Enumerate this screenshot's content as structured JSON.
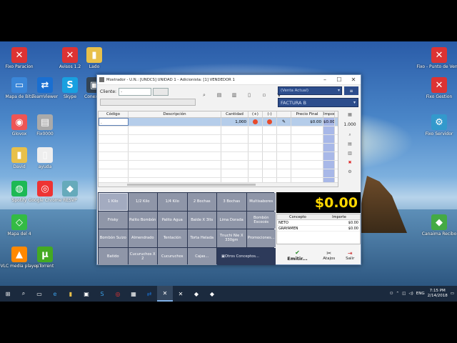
{
  "desktop": {
    "icons_left": [
      {
        "label": "Fixo Paracion",
        "glyph": "✕",
        "color": "#d33"
      },
      {
        "label": "Avisos 1.2",
        "glyph": "✕",
        "color": "#d33"
      },
      {
        "label": "Lado",
        "glyph": "▮",
        "color": "#e8c04a"
      },
      {
        "label": "Mapa de Bits",
        "glyph": "▭",
        "color": "#3a86d8"
      },
      {
        "label": "TeamViewer",
        "glyph": "⇄",
        "color": "#1a6fd1"
      },
      {
        "label": "Skype",
        "glyph": "S",
        "color": "#19a0e0"
      },
      {
        "label": "Conexion",
        "glyph": "▣",
        "color": "#345"
      },
      {
        "label": "Glovox",
        "glyph": "◉",
        "color": "#e55"
      },
      {
        "label": "Fix0000",
        "glyph": "▤",
        "color": "#aaa"
      },
      {
        "label": "David",
        "glyph": "▮",
        "color": "#e8c04a"
      },
      {
        "label": "ayuda",
        "glyph": "▯",
        "color": "#eee"
      },
      {
        "label": "Spotify",
        "glyph": "◍",
        "color": "#1db954"
      },
      {
        "label": "Google Chrome",
        "glyph": "◎",
        "color": "#e33"
      },
      {
        "label": "RESVP",
        "glyph": "◆",
        "color": "#6ab"
      },
      {
        "label": "Mapa del 4",
        "glyph": "◇",
        "color": "#3b4"
      },
      {
        "label": "VLC media player",
        "glyph": "▲",
        "color": "#f80"
      },
      {
        "label": "µTorrent",
        "glyph": "µ",
        "color": "#4a2"
      }
    ],
    "icons_right": [
      {
        "label": "Fixo - Punto de Venta",
        "glyph": "✕",
        "color": "#d33"
      },
      {
        "label": "Fixo Gestion",
        "glyph": "✕",
        "color": "#d33"
      },
      {
        "label": "Fixo Servidor",
        "glyph": "⚙",
        "color": "#39c"
      },
      {
        "label": "Canaima Recibo",
        "glyph": "◆",
        "color": "#4a4"
      }
    ]
  },
  "window": {
    "title": "Mostrador - U.N.: [UNDCS] UNIDAD 1 - Adicionista: [1] VENDEDOR 1",
    "cliente_label": "Cliente:",
    "cliente_value": ".",
    "venta_tipo": "(Venta Actual)",
    "factura": "FACTURA B",
    "grid": {
      "headers": [
        "Código",
        "Descripción",
        "Cantidad",
        "(+)",
        "(-)",
        "",
        "Precio Final",
        "Impor"
      ],
      "first_row": {
        "code": ".",
        "cantidad": "1,000",
        "precio": "$0.00",
        "importe": "$0.00"
      }
    },
    "side_qty": "1.000",
    "buttons": [
      "1 Kilo",
      "1/2 Kilo",
      "1/4 Kilo",
      "2 Bochas",
      "3 Bochas",
      "Multisabores",
      "Frisky",
      "Palito Bombón",
      "Palito Agua",
      "Balde X 3lts",
      "Lima Dorada",
      "Bombón Escocés",
      "Bombón Suizo",
      "Almendrado",
      "Tentación",
      "Torta Helada",
      "Tnuchi Nie X 330gm",
      "Promociones...",
      "Batido",
      "Cucuruchos X 2",
      "Cucuruchos",
      "Cajas..."
    ],
    "otros_label": "Otros Conceptos...",
    "total": "$0.00",
    "concept_headers": [
      "Concepto",
      "Importe"
    ],
    "concepts": [
      {
        "name": "NETO",
        "amount": "$0.00"
      },
      {
        "name": "GRAYAMEN",
        "amount": "$0.00"
      }
    ],
    "actions": {
      "emitir": "Emitir...",
      "atajos": "Atajos",
      "salir": "Salir"
    }
  },
  "taskbar": {
    "language": "ENG",
    "time": "7:15 PM",
    "date": "2/14/2018"
  }
}
